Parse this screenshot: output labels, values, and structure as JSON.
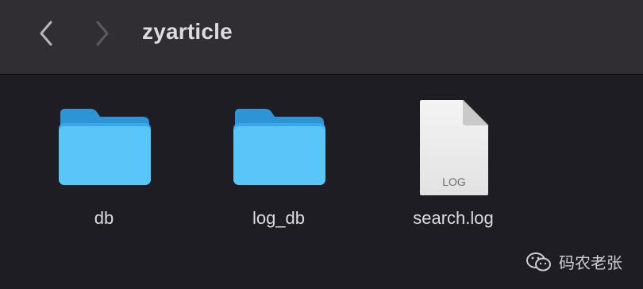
{
  "toolbar": {
    "back_icon": "chevron-left-icon",
    "forward_icon": "chevron-right-icon",
    "title": "zyarticle"
  },
  "files": [
    {
      "name": "db",
      "kind": "folder"
    },
    {
      "name": "log_db",
      "kind": "folder"
    },
    {
      "name": "search.log",
      "kind": "document",
      "badge": "LOG"
    }
  ],
  "watermark": {
    "text": "码农老张",
    "icon": "wechat-icon"
  },
  "colors": {
    "toolbar_bg": "#302e33",
    "content_bg": "#1f1d24",
    "folder_blue": "#56c3f7",
    "text": "#dcdbde"
  }
}
